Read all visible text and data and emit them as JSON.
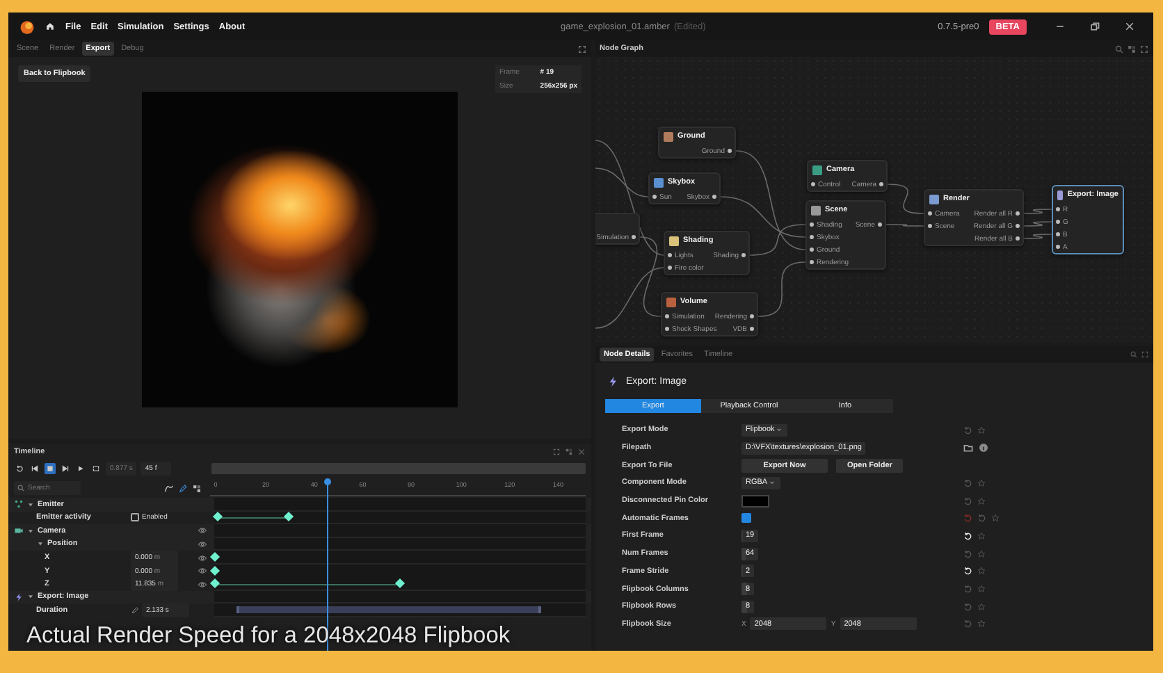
{
  "window": {
    "title": "game_explosion_01.amber",
    "title_note": "(Edited)",
    "version": "0.7.5-pre0",
    "badge": "BETA"
  },
  "menu": [
    "File",
    "Edit",
    "Simulation",
    "Settings",
    "About"
  ],
  "viewer": {
    "tabs": [
      {
        "label": "Scene",
        "selected": false
      },
      {
        "label": "Render",
        "selected": false
      },
      {
        "label": "Export",
        "selected": true
      },
      {
        "label": "Debug",
        "selected": false
      }
    ],
    "back_button": "Back to Flipbook",
    "info": [
      {
        "label": "Frame",
        "value": "# 19"
      },
      {
        "label": "Size",
        "value": "256x256 px"
      }
    ]
  },
  "node_graph": {
    "title": "Node Graph",
    "nodes": [
      {
        "selected": false,
        "outputs": [
          "Simulation"
        ]
      },
      {
        "title": "Ground",
        "selected": false,
        "outputs": [
          "Ground"
        ]
      },
      {
        "title": "Skybox",
        "selected": false,
        "inputs": [
          "Sun"
        ],
        "outputs": [
          "Skybox"
        ]
      },
      {
        "title": "Shading",
        "selected": false,
        "inputs": [
          "Lights",
          "Fire color"
        ],
        "outputs": [
          "Shading"
        ]
      },
      {
        "title": "Volume",
        "selected": false,
        "inputs": [
          "Simulation",
          "Shock Shapes"
        ],
        "outputs": [
          "Rendering",
          "VDB"
        ]
      },
      {
        "title": "Camera",
        "selected": false,
        "inputs": [
          "Control"
        ],
        "outputs": [
          "Camera"
        ]
      },
      {
        "title": "Scene",
        "selected": false,
        "inputs": [
          "Shading",
          "Skybox",
          "Ground",
          "Rendering"
        ],
        "outputs": [
          "Scene"
        ]
      },
      {
        "title": "Render",
        "selected": false,
        "inputs": [
          "Camera",
          "Scene"
        ],
        "outputs": [
          "Render all R",
          "Render all G",
          "Render all B"
        ]
      },
      {
        "title": "Export: Image",
        "selected": true,
        "inputs": [
          "R",
          "G",
          "B",
          "A"
        ]
      }
    ]
  },
  "node_details": {
    "tabs": [
      {
        "label": "Node Details",
        "selected": true
      },
      {
        "label": "Favorites",
        "selected": false
      },
      {
        "label": "Timeline",
        "selected": false
      }
    ],
    "title": "Export: Image",
    "subtabs": [
      {
        "label": "Export",
        "selected": true
      },
      {
        "label": "Playback Control",
        "selected": false
      },
      {
        "label": "Info",
        "selected": false
      }
    ],
    "properties": [
      {
        "kind": "select",
        "label": "Export Mode",
        "value": "Flipbook"
      },
      {
        "kind": "text",
        "label": "Filepath",
        "value": "D:\\VFX\\textures\\explosion_01.png"
      },
      {
        "kind": "buttons",
        "label": "Export To File",
        "buttons": [
          "Export Now",
          "Open Folder"
        ]
      },
      {
        "kind": "select",
        "label": "Component Mode",
        "value": "RGBA"
      },
      {
        "kind": "color",
        "label": "Disconnected Pin Color",
        "color": "#000000"
      },
      {
        "kind": "checkbox",
        "label": "Automatic Frames",
        "checked": true
      },
      {
        "kind": "slider",
        "label": "First Frame",
        "value": "19",
        "level": 0.04,
        "modified": true
      },
      {
        "kind": "slider",
        "label": "Num Frames",
        "value": "64",
        "level": 0.26,
        "modified": false
      },
      {
        "kind": "slider",
        "label": "Frame Stride",
        "value": "2",
        "level": 0.03,
        "modified": true
      },
      {
        "kind": "slider",
        "label": "Flipbook Columns",
        "value": "8",
        "level": 0.47,
        "modified": false
      },
      {
        "kind": "slider",
        "label": "Flipbook Rows",
        "value": "8",
        "level": 0.47,
        "modified": false
      },
      {
        "kind": "vector",
        "label": "Flipbook Size",
        "fields": [
          {
            "axis": "X",
            "value": "2048"
          },
          {
            "axis": "Y",
            "value": "2048"
          }
        ]
      }
    ]
  },
  "timeline": {
    "title": "Timeline",
    "time": "0.877 s",
    "frame": "45 f",
    "search": {
      "placeholder": "Search"
    },
    "ruler": [
      "0",
      "20",
      "40",
      "60",
      "80",
      "100",
      "120",
      "140"
    ],
    "playhead": {
      "level": 0.31
    },
    "tracks": [
      {
        "kind": "group",
        "label": "Emitter",
        "expanded": true,
        "children": [
          {
            "kind": "checkbox",
            "label": "Emitter activity",
            "checked": false,
            "value": "Enabled",
            "keys": [
              {
                "level": 0.01
              },
              {
                "level": 0.2
              }
            ]
          }
        ]
      },
      {
        "kind": "group",
        "label": "Camera",
        "expanded": true,
        "children": [
          {
            "kind": "group",
            "label": "Position",
            "expanded": true,
            "children": [
              {
                "kind": "number",
                "label": "X",
                "value": "0.000",
                "unit": "m",
                "keys": [
                  {
                    "level": 0
                  }
                ]
              },
              {
                "kind": "number",
                "label": "Y",
                "value": "0.000",
                "unit": "m",
                "keys": [
                  {
                    "level": 0
                  }
                ]
              },
              {
                "kind": "number",
                "label": "Z",
                "value": "11.835",
                "unit": "m",
                "keys": [
                  {
                    "level": 0
                  },
                  {
                    "level": 0.5
                  }
                ]
              }
            ]
          }
        ]
      },
      {
        "kind": "group",
        "label": "Export: Image",
        "expanded": true,
        "children": [
          {
            "kind": "duration",
            "label": "Duration",
            "value": "2.133 s",
            "span": [
              {
                "level": 0.06
              },
              {
                "level": 0.88
              }
            ]
          }
        ]
      }
    ]
  },
  "caption": "Actual Render Speed for a 2048x2048 Flipbook"
}
